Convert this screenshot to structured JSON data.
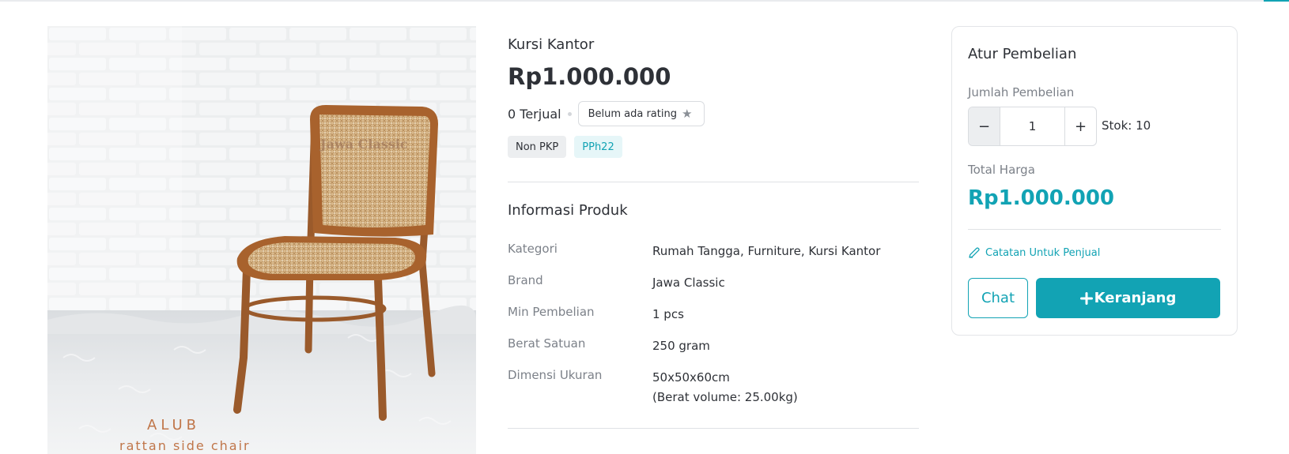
{
  "colors": {
    "accent": "#12a3b4",
    "text": "#2e3137",
    "muted": "#7c8189"
  },
  "image": {
    "watermark": "Jawa Classic",
    "model_name": "ALUB",
    "model_subtitle": "rattan side chair"
  },
  "product": {
    "name": "Kursi Kantor",
    "price": "Rp1.000.000",
    "sold": "0 Terjual",
    "rating": "Belum ada rating",
    "rating_icon": "star-icon",
    "tags": [
      "Non PKP",
      "PPh22"
    ]
  },
  "info": {
    "title": "Informasi Produk",
    "specs": [
      {
        "label": "Kategori",
        "value": "Rumah Tangga, Furniture, Kursi Kantor"
      },
      {
        "label": "Brand",
        "value": "Jawa Classic"
      },
      {
        "label": "Min Pembelian",
        "value": "1 pcs"
      },
      {
        "label": "Berat Satuan",
        "value": "250 gram"
      },
      {
        "label": "Dimensi Ukuran",
        "value": "50x50x60cm",
        "value_2": "(Berat volume: 25.00kg)"
      }
    ]
  },
  "purchase": {
    "title": "Atur Pembelian",
    "qty_label": "Jumlah Pembelian",
    "minus": "−",
    "qty": "1",
    "plus": "+",
    "stock": "Stok: 10",
    "total_label": "Total Harga",
    "total": "Rp1.000.000",
    "note_icon": "pencil-icon",
    "note": "Catatan Untuk Penjual",
    "chat": "Chat",
    "cart_icon": "plus-icon",
    "cart": "Keranjang"
  }
}
